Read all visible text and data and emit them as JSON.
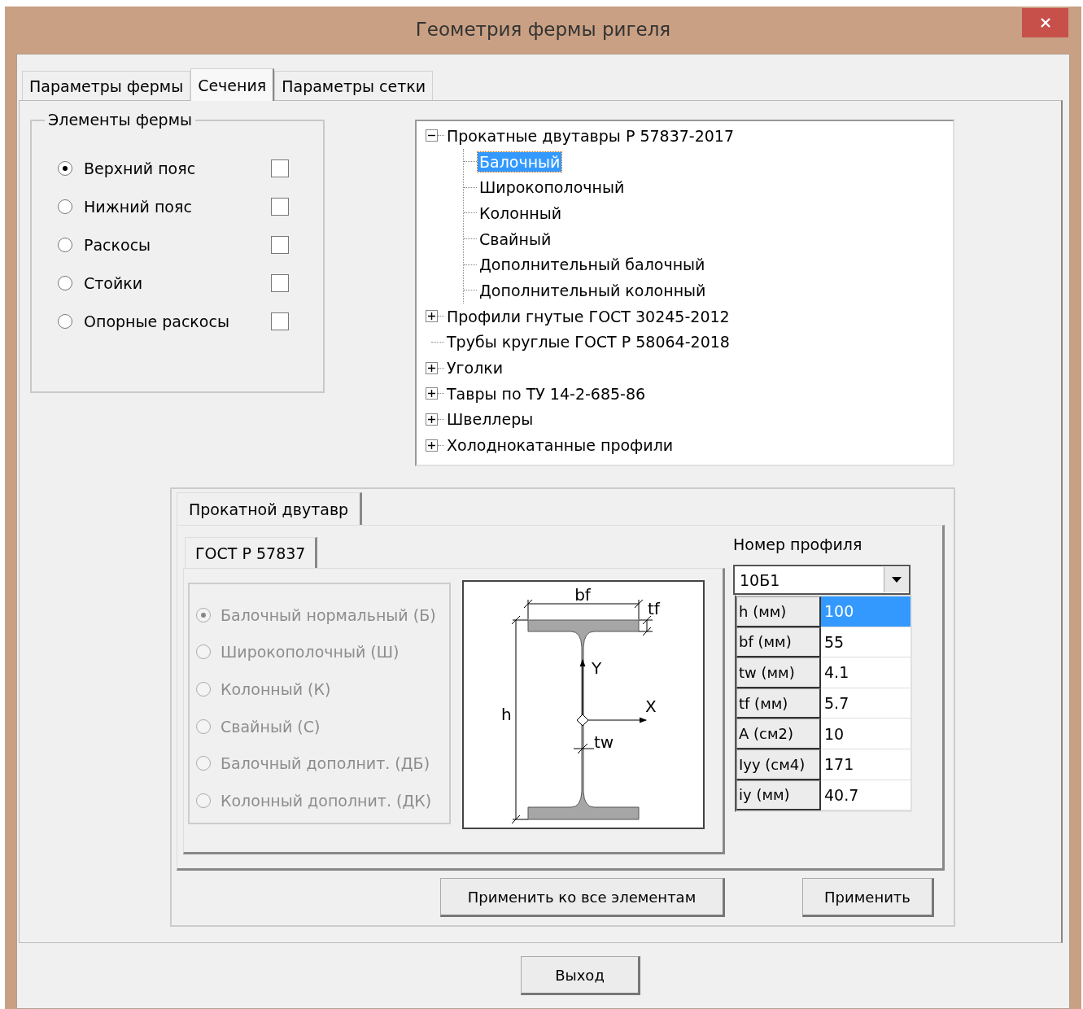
{
  "window": {
    "title": "Геометрия фермы ригеля"
  },
  "tabs": [
    {
      "label": "Параметры фермы",
      "selected": false
    },
    {
      "label": "Сечения",
      "selected": true
    },
    {
      "label": "Параметры сетки",
      "selected": false
    }
  ],
  "elements_group": {
    "title": "Элементы фермы",
    "items": [
      {
        "label": "Верхний пояс",
        "selected": true,
        "checked": false
      },
      {
        "label": "Нижний пояс",
        "selected": false,
        "checked": false
      },
      {
        "label": "Раскосы",
        "selected": false,
        "checked": false
      },
      {
        "label": "Стойки",
        "selected": false,
        "checked": false
      },
      {
        "label": "Опорные раскосы",
        "selected": false,
        "checked": false
      }
    ]
  },
  "tree": {
    "items": [
      {
        "label": "Прокатные двутавры Р 57837-2017",
        "kind": "node",
        "expanded": true,
        "selected": false,
        "children": [
          {
            "label": "Балочный",
            "selected": true
          },
          {
            "label": "Широкополочный",
            "selected": false
          },
          {
            "label": "Колонный",
            "selected": false
          },
          {
            "label": "Свайный",
            "selected": false
          },
          {
            "label": "Дополнительный балочный",
            "selected": false
          },
          {
            "label": "Дополнительный колонный",
            "selected": false
          }
        ]
      },
      {
        "label": "Профили гнутые ГОСТ 30245-2012",
        "kind": "node",
        "expanded": false,
        "selected": false
      },
      {
        "label": "Трубы круглые ГОСТ Р 58064-2018",
        "kind": "leaf",
        "selected": false
      },
      {
        "label": "Уголки",
        "kind": "node",
        "expanded": false,
        "selected": false
      },
      {
        "label": "Тавры по ТУ 14-2-685-86",
        "kind": "node",
        "expanded": false,
        "selected": false
      },
      {
        "label": "Швеллеры",
        "kind": "node",
        "expanded": false,
        "selected": false
      },
      {
        "label": "Холоднокатанные профили",
        "kind": "node",
        "expanded": false,
        "selected": false
      }
    ]
  },
  "section_panel": {
    "tab": "Прокатной двутавр",
    "subtab": "ГОСТ Р 57837",
    "types": [
      {
        "label": "Балочный нормальный (Б)",
        "selected": true,
        "disabled": true
      },
      {
        "label": "Широкополочный (Ш)",
        "selected": false,
        "disabled": true
      },
      {
        "label": "Колонный (К)",
        "selected": false,
        "disabled": true
      },
      {
        "label": "Свайный (С)",
        "selected": false,
        "disabled": true
      },
      {
        "label": "Балочный дополнит. (ДБ)",
        "selected": false,
        "disabled": true
      },
      {
        "label": "Колонный дополнит. (ДК)",
        "selected": false,
        "disabled": true
      }
    ],
    "diagram": {
      "bf": "bf",
      "tf": "tf",
      "h": "h",
      "y_axis": "Y",
      "x_axis": "X",
      "tw": "tw"
    },
    "profile_label": "Номер профиля",
    "profile_value": "10Б1",
    "properties": [
      {
        "name": "h (мм)",
        "value": "100",
        "selected": true
      },
      {
        "name": "bf (мм)",
        "value": "55",
        "selected": false
      },
      {
        "name": "tw (мм)",
        "value": "4.1",
        "selected": false
      },
      {
        "name": "tf (мм)",
        "value": "5.7",
        "selected": false
      },
      {
        "name": "A (см2)",
        "value": "10",
        "selected": false
      },
      {
        "name": "Iyy (см4)",
        "value": "171",
        "selected": false
      },
      {
        "name": "iy (мм)",
        "value": "40.7",
        "selected": false
      }
    ]
  },
  "buttons": {
    "apply_all": "Применить ко все элементам",
    "apply": "Применить"
  },
  "exit_button": "Выход"
}
